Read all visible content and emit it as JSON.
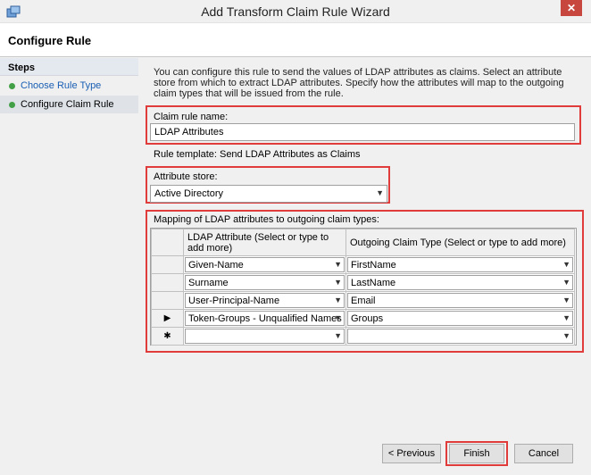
{
  "window": {
    "title": "Add Transform Claim Rule Wizard",
    "close_glyph": "✕"
  },
  "header": {
    "title": "Configure Rule"
  },
  "steps": {
    "heading": "Steps",
    "items": [
      {
        "label": "Choose Rule Type"
      },
      {
        "label": "Configure Claim Rule"
      }
    ]
  },
  "main": {
    "description": "You can configure this rule to send the values of LDAP attributes as claims. Select an attribute store from which to extract LDAP attributes. Specify how the attributes will map to the outgoing claim types that will be issued from the rule.",
    "claim_rule_name_label": "Claim rule name:",
    "claim_rule_name_value": "LDAP Attributes",
    "rule_template": "Rule template: Send LDAP Attributes as Claims",
    "attribute_store_label": "Attribute store:",
    "attribute_store_value": "Active Directory",
    "mapping_label": "Mapping of LDAP attributes to outgoing claim types:",
    "columns": {
      "ldap": "LDAP Attribute (Select or type to add more)",
      "outgoing": "Outgoing Claim Type (Select or type to add more)"
    },
    "rows": [
      {
        "marker": "",
        "ldap": "Given-Name",
        "outgoing": "FirstName"
      },
      {
        "marker": "",
        "ldap": "Surname",
        "outgoing": "LastName"
      },
      {
        "marker": "",
        "ldap": "User-Principal-Name",
        "outgoing": "Email"
      },
      {
        "marker": "▶",
        "ldap": "Token-Groups - Unqualified Names",
        "outgoing": "Groups"
      },
      {
        "marker": "✱",
        "ldap": "",
        "outgoing": ""
      }
    ]
  },
  "buttons": {
    "previous": "< Previous",
    "finish": "Finish",
    "cancel": "Cancel"
  },
  "colors": {
    "highlight": "#e03c3c",
    "link": "#1a5fb4",
    "step_dot": "#43a047"
  }
}
